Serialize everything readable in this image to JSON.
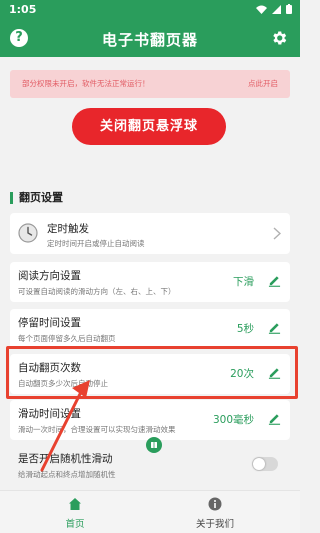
{
  "status_bar": {
    "time": "1:05"
  },
  "app_bar": {
    "title": "电子书翻页器",
    "help_symbol": "?"
  },
  "warning": {
    "message": "部分权限未开启，软件无法正常运行！",
    "action": "点此开启"
  },
  "primary_button": {
    "label": "关闭翻页悬浮球"
  },
  "section": {
    "title": "翻页设置"
  },
  "settings": {
    "timer": {
      "title": "定时触发",
      "desc": "定时时间开启或停止自动阅读"
    },
    "direction": {
      "title": "阅读方向设置",
      "desc": "可设置自动阅读的滑动方向（左、右、上、下）",
      "value": "下滑"
    },
    "dwell": {
      "title": "停留时间设置",
      "desc": "每个页面停留多久后自动翻页",
      "value": "5秒"
    },
    "count": {
      "title": "自动翻页次数",
      "desc": "自动翻页多少次后自动停止",
      "value": "20次"
    },
    "swipe": {
      "title": "滑动时间设置",
      "desc": "滑动一次时间，合理设置可以实现匀速滑动效果",
      "value": "300毫秒"
    },
    "random": {
      "title": "是否开启随机性滑动",
      "desc": "给滑动起点和终点增加随机性",
      "enabled": false
    }
  },
  "tabs": {
    "home": "首页",
    "about": "关于我们"
  },
  "colors": {
    "primary": "#2a9d5c",
    "danger": "#e8262b",
    "warning_bg": "#f7d2d4",
    "annotation": "#e8412f"
  },
  "icons": [
    "help-icon",
    "gear-icon",
    "clock-icon",
    "chevron-right-icon",
    "pencil-icon",
    "home-icon",
    "info-icon",
    "wifi-icon",
    "signal-icon",
    "battery-icon"
  ]
}
